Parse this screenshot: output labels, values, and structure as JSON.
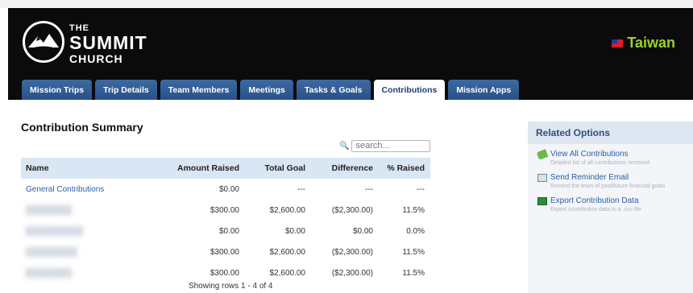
{
  "header": {
    "logo_line1": "THE",
    "logo_line2": "SUMMIT",
    "logo_line3": "CHURCH",
    "location": "Taiwan",
    "accent_color": "#9bd22c"
  },
  "tabs": [
    {
      "label": "Mission Trips"
    },
    {
      "label": "Trip Details"
    },
    {
      "label": "Team Members"
    },
    {
      "label": "Meetings"
    },
    {
      "label": "Tasks & Goals"
    },
    {
      "label": "Contributions",
      "active": true
    },
    {
      "label": "Mission Apps"
    }
  ],
  "main": {
    "title": "Contribution Summary",
    "search_placeholder": "search...",
    "columns": [
      "Name",
      "Amount Raised",
      "Total Goal",
      "Difference",
      "% Raised"
    ],
    "rows": [
      {
        "name": "General Contributions",
        "raised": "$0.00",
        "goal": "---",
        "diff": "---",
        "pct": "---"
      },
      {
        "name": "",
        "raised": "$300.00",
        "goal": "$2,600.00",
        "diff": "($2,300.00)",
        "pct": "11.5%"
      },
      {
        "name": "",
        "raised": "$0.00",
        "goal": "$0.00",
        "diff": "$0.00",
        "pct": "0.0%"
      },
      {
        "name": "",
        "raised": "$300.00",
        "goal": "$2,600.00",
        "diff": "($2,300.00)",
        "pct": "11.5%"
      },
      {
        "name": "",
        "raised": "$300.00",
        "goal": "$2,600.00",
        "diff": "($2,300.00)",
        "pct": "11.5%"
      }
    ],
    "pager": "Showing rows 1 - 4 of 4"
  },
  "sidebar": {
    "title": "Related Options",
    "options": [
      {
        "title": "View All Contributions",
        "desc": "Detailed list of all contributions received",
        "icon": "tag-icon"
      },
      {
        "title": "Send Reminder Email",
        "desc": "Remind the team of past/future financial goals",
        "icon": "mail-icon"
      },
      {
        "title": "Export Contribution Data",
        "desc": "Export contribution data to a .csv file",
        "icon": "spreadsheet-icon"
      }
    ]
  }
}
